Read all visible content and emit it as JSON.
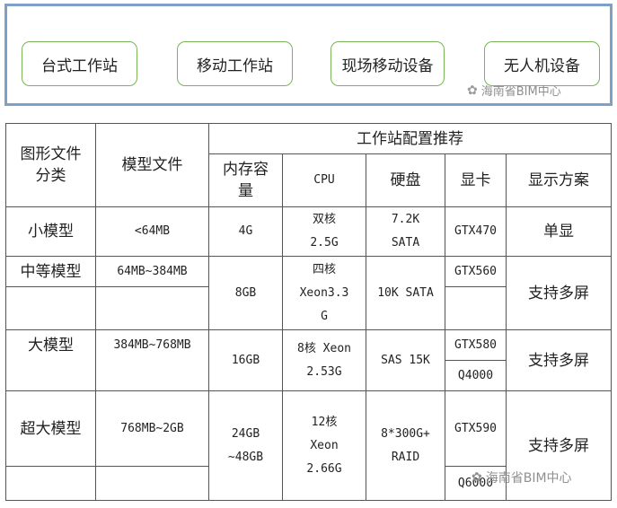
{
  "categories": [
    "台式工作站",
    "移动工作站",
    "现场移动设备",
    "无人机设备"
  ],
  "watermark": "海南省BIM中心",
  "table": {
    "headers": {
      "category": "图形文件\n分类",
      "file": "模型文件",
      "group": "工作站配置推荐",
      "memory": "内存容\n量",
      "cpu": "CPU",
      "disk": "硬盘",
      "gpu": "显卡",
      "display": "显示方案"
    },
    "rows": {
      "small": {
        "category": "小模型",
        "file": "<64MB",
        "memory": "4G",
        "cpu": "双核\n2.5G",
        "disk": "7.2K\nSATA",
        "gpu": "GTX470",
        "display": "单显"
      },
      "medium": {
        "category": "中等模型",
        "file": "64MB~384MB",
        "memory": "8GB",
        "cpu": "四核\nXeon3.3\nG",
        "disk": "10K SATA",
        "gpu": "GTX560",
        "display": "支持多屏"
      },
      "large": {
        "category": "大模型",
        "file": "384MB~768MB",
        "memory": "16GB",
        "cpu": "8核 Xeon\n2.53G",
        "disk": "SAS 15K",
        "gpu1": "GTX580",
        "gpu2": "Q4000",
        "display": "支持多屏"
      },
      "xlarge": {
        "category": "超大模型",
        "file": "768MB~2GB",
        "memory": "24GB\n~48GB",
        "cpu": "12核\nXeon\n2.66G",
        "disk": "8*300G+\nRAID",
        "gpu1": "GTX590",
        "gpu2": "Q6000",
        "display": "支持多屏"
      }
    }
  }
}
